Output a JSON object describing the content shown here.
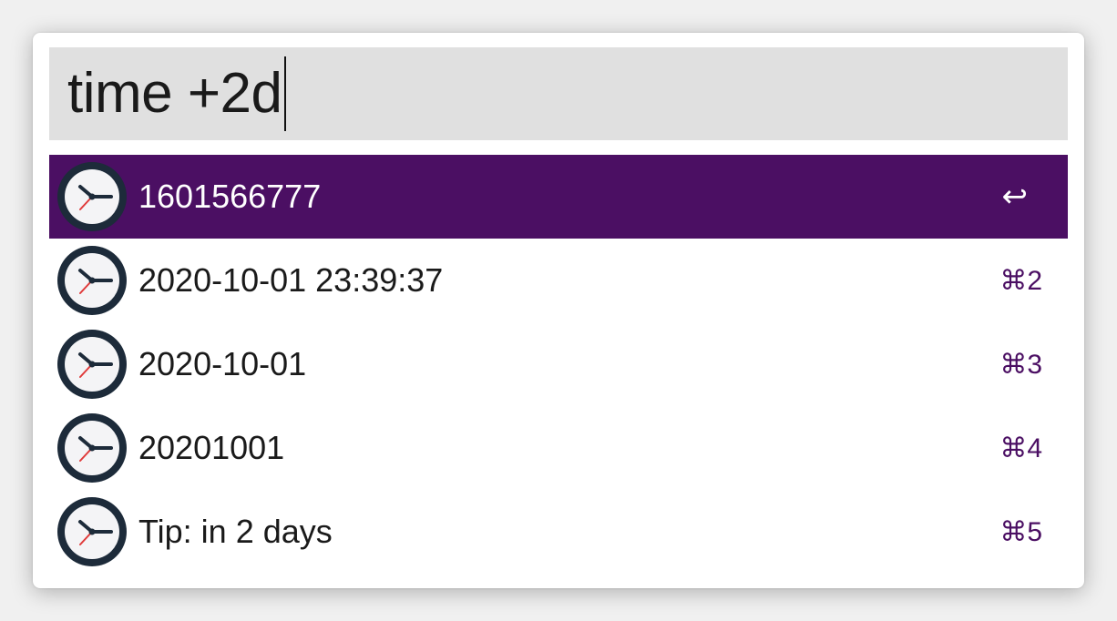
{
  "search": {
    "query": "time +2d"
  },
  "results": [
    {
      "title": "1601566777",
      "shortcut": "↩",
      "selected": true
    },
    {
      "title": "2020-10-01 23:39:37",
      "shortcut": "⌘2",
      "selected": false
    },
    {
      "title": "2020-10-01",
      "shortcut": "⌘3",
      "selected": false
    },
    {
      "title": "20201001",
      "shortcut": "⌘4",
      "selected": false
    },
    {
      "title": "Tip: in 2 days",
      "shortcut": "⌘5",
      "selected": false
    }
  ],
  "icon": "clock-icon",
  "colors": {
    "selection": "#4b0f63",
    "search_background": "#e0e0e0",
    "shortcut": "#4b0f63"
  }
}
